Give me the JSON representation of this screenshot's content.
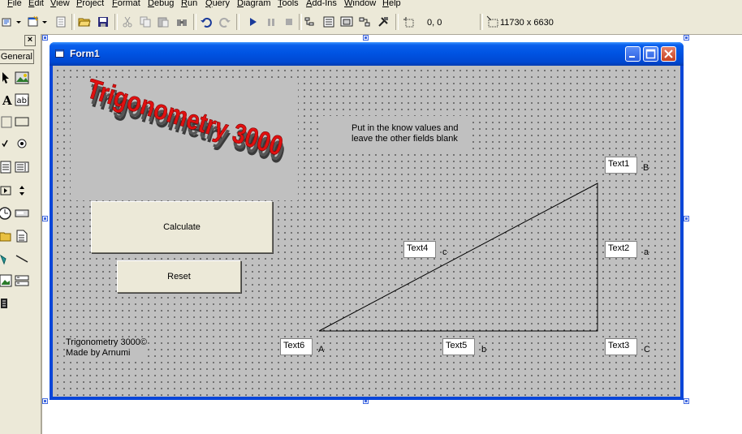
{
  "menu": {
    "items": [
      "File",
      "Edit",
      "View",
      "Project",
      "Format",
      "Debug",
      "Run",
      "Query",
      "Diagram",
      "Tools",
      "Add-Ins",
      "Window",
      "Help"
    ]
  },
  "toolbar": {
    "position_readout": "0, 0",
    "size_readout": "11730 x 6630"
  },
  "toolbox": {
    "tab_label": "General",
    "close_glyph": "×"
  },
  "form": {
    "title": "Form1",
    "logo_text": "Trigonometry 3000",
    "instructions_line1": "Put in the know values and",
    "instructions_line2": "leave the other fields blank",
    "calculate_label": "Calculate",
    "reset_label": "Reset",
    "credits_line1": "Trigonometry 3000©",
    "credits_line2": "Made by Arnumi",
    "textboxes": {
      "text1": "Text1",
      "text2": "Text2",
      "text3": "Text3",
      "text4": "Text4",
      "text5": "Text5",
      "text6": "Text6"
    },
    "vertex_labels": {
      "A": "A",
      "B": "B",
      "C": "C"
    },
    "side_labels": {
      "a": "a",
      "b": "b",
      "c": "c"
    }
  },
  "colors": {
    "titlebar": "#0054e3",
    "form_background": "#c0c0c0",
    "logo_red": "#e01010",
    "logo_shadow": "#3a3a3a"
  }
}
